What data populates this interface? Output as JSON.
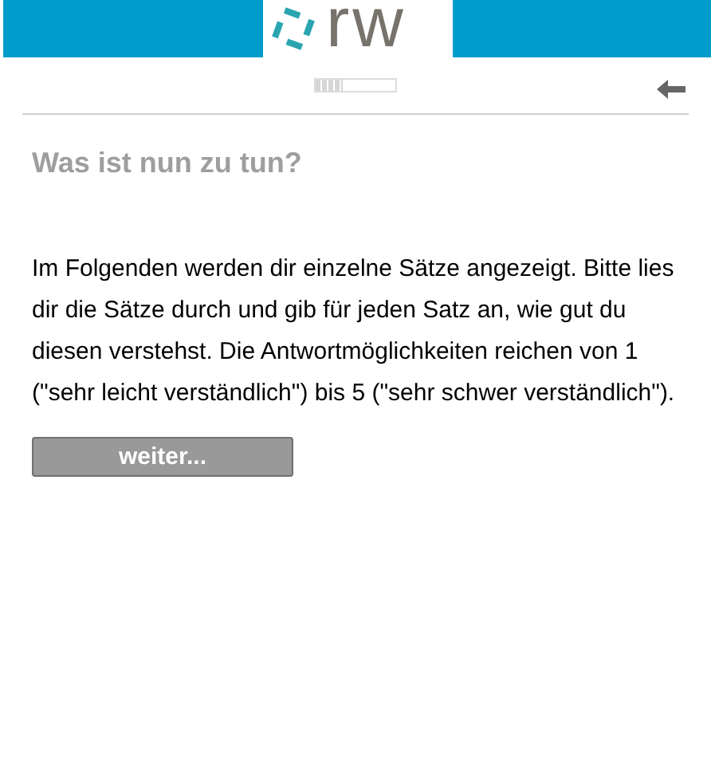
{
  "header": {
    "logo_text": "rw"
  },
  "progress": {
    "level": 0.33
  },
  "title": "Was ist nun zu tun?",
  "instructions": "Im Folgenden werden dir einzelne Sätze angezeigt. Bitte lies dir die Sätze durch und gib für jeden Satz an, wie gut du diesen verstehst. Die Antwortmöglichkeiten reichen von 1 (\"sehr leicht verständlich\") bis 5 (\"sehr schwer verständlich\").",
  "button": {
    "label": "weiter..."
  }
}
